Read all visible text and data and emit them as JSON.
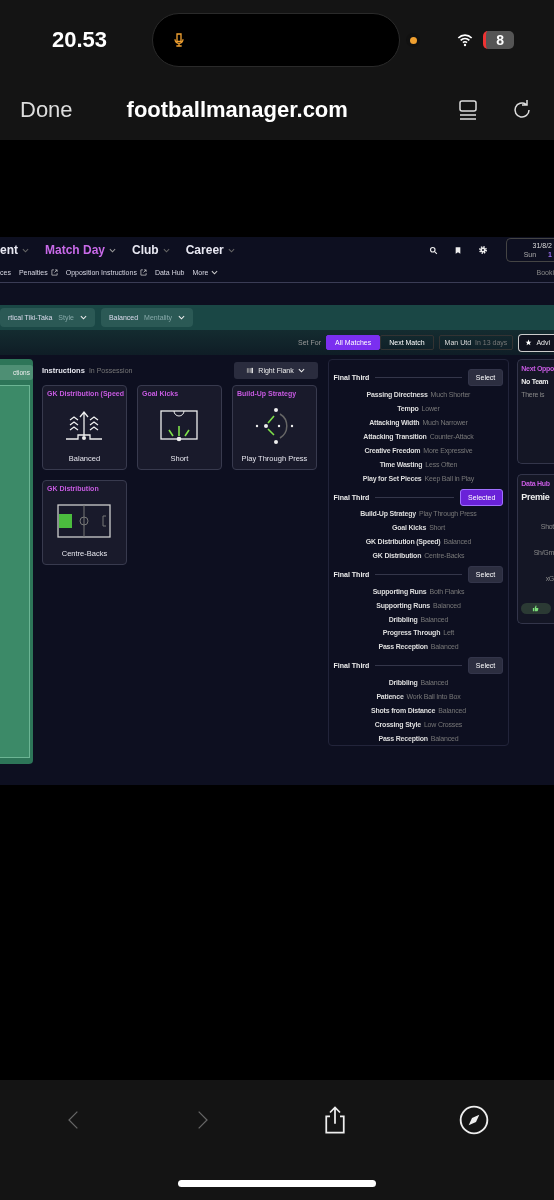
{
  "status_bar": {
    "time": "20.53",
    "battery": "8"
  },
  "browser": {
    "done": "Done",
    "url": "footballmanager.com"
  },
  "nav": {
    "primary": [
      {
        "label": "ent",
        "selected": false
      },
      {
        "label": "Match Day",
        "selected": true
      },
      {
        "label": "Club",
        "selected": false
      },
      {
        "label": "Career",
        "selected": false
      }
    ],
    "secondary": [
      {
        "label": "ces",
        "kind": "link"
      },
      {
        "label": "Penalties",
        "kind": "external"
      },
      {
        "label": "Opposition Instructions",
        "kind": "external"
      },
      {
        "label": "Data Hub",
        "kind": "link"
      },
      {
        "label": "More",
        "kind": "menu"
      }
    ],
    "date": "31/8/2",
    "day": "Sun",
    "time": "1",
    "bookings": "Booki"
  },
  "tactic_bar": {
    "dropdowns": [
      {
        "value": "rtical Tiki-Taka",
        "label": "Style"
      },
      {
        "value": "Balanced",
        "label": "Mentality"
      }
    ]
  },
  "set_for": {
    "label": "Set For",
    "options": [
      {
        "label": "All Matches",
        "selected": true
      },
      {
        "label": "Next Match",
        "selected": false
      }
    ],
    "opponent": "Man Utd",
    "when": "In 13 days",
    "advice": "Advi"
  },
  "pitch_panel": {
    "button": "ctions"
  },
  "instructions": {
    "title": "Instructions",
    "subtitle": "In Possession",
    "flank": "Right Flank",
    "cards": [
      {
        "title": "GK Distribution (Speed",
        "value": "Balanced",
        "kind": "arrows"
      },
      {
        "title": "Goal Kicks",
        "value": "Short",
        "kind": "box"
      },
      {
        "title": "Build-Up Strategy",
        "value": "Play Through Press",
        "kind": "press"
      },
      {
        "title": "GK Distribution",
        "value": "Centre-Backs",
        "kind": "pitch"
      }
    ]
  },
  "groups": [
    {
      "title": "Final Third",
      "button": "Select",
      "selected": false,
      "rows": [
        {
          "name": "Passing Directness",
          "value": "Much Shorter"
        },
        {
          "name": "Tempo",
          "value": "Lower"
        },
        {
          "name": "Attacking Width",
          "value": "Much Narrower"
        },
        {
          "name": "Attacking Transition",
          "value": "Counter-Attack"
        },
        {
          "name": "Creative Freedom",
          "value": "More Expressive"
        },
        {
          "name": "Time Wasting",
          "value": "Less Often"
        },
        {
          "name": "Play for Set Pieces",
          "value": "Keep Ball in Play"
        }
      ]
    },
    {
      "title": "Final Third",
      "button": "Selected",
      "selected": true,
      "rows": [
        {
          "name": "Build-Up Strategy",
          "value": "Play Through Press"
        },
        {
          "name": "Goal Kicks",
          "value": "Short"
        },
        {
          "name": "GK Distribution (Speed)",
          "value": "Balanced"
        },
        {
          "name": "GK Distribution",
          "value": "Centre-Backs"
        }
      ]
    },
    {
      "title": "Final Third",
      "button": "Select",
      "selected": false,
      "rows": [
        {
          "name": "Supporting Runs",
          "value": "Both Flanks"
        },
        {
          "name": "Supporting Runs",
          "value": "Balanced"
        },
        {
          "name": "Dribbling",
          "value": "Balanced"
        },
        {
          "name": "Progress Through",
          "value": "Left"
        },
        {
          "name": "Pass Reception",
          "value": "Balanced"
        }
      ]
    },
    {
      "title": "Final Third",
      "button": "Select",
      "selected": false,
      "rows": [
        {
          "name": "Dribbling",
          "value": "Balanced"
        },
        {
          "name": "Patience",
          "value": "Work Ball Into Box"
        },
        {
          "name": "Shots from Distance",
          "value": "Balanced"
        },
        {
          "name": "Crossing Style",
          "value": "Low Crosses"
        },
        {
          "name": "Pass Reception",
          "value": "Balanced"
        }
      ]
    }
  ],
  "next_opponent": {
    "title": "Next Oppo",
    "team": "No Team",
    "text": "There is"
  },
  "data_hub": {
    "title": "Data Hub",
    "league": "Premie",
    "stats": [
      "Shot",
      "Sh/Gm",
      "xG"
    ]
  }
}
